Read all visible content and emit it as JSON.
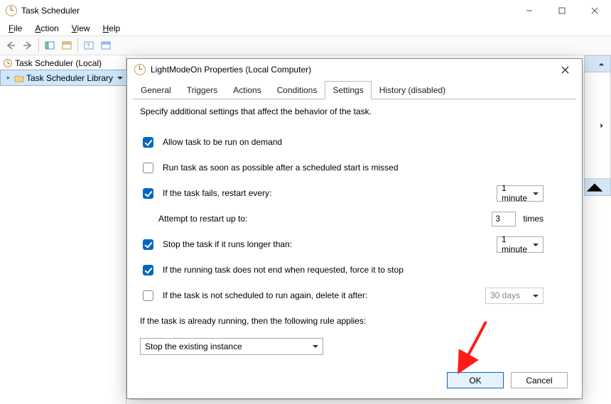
{
  "app": {
    "title": "Task Scheduler"
  },
  "menu": {
    "file": "File",
    "action": "Action",
    "view": "View",
    "help": "Help"
  },
  "tree": {
    "root": "Task Scheduler (Local)",
    "child": "Task Scheduler Library"
  },
  "dialog": {
    "title": "LightModeOn Properties (Local Computer)",
    "tabs": {
      "general": "General",
      "triggers": "Triggers",
      "actions": "Actions",
      "conditions": "Conditions",
      "settings": "Settings",
      "history": "History (disabled)"
    },
    "desc": "Specify additional settings that affect the behavior of the task.",
    "opts": {
      "allow_on_demand": "Allow task to be run on demand",
      "run_asap": "Run task as soon as possible after a scheduled start is missed",
      "fails_restart": "If the task fails, restart every:",
      "fails_interval": "1 minute",
      "restart_upto": "Attempt to restart up to:",
      "restart_count": "3",
      "restart_times": "times",
      "stop_longer": "Stop the task if it runs longer than:",
      "stop_duration": "1 minute",
      "force_stop": "If the running task does not end when requested, force it to stop",
      "delete_after": "If the task is not scheduled to run again, delete it after:",
      "delete_days": "30 days",
      "already_running": "If the task is already running, then the following rule applies:",
      "rule_selected": "Stop the existing instance"
    },
    "buttons": {
      "ok": "OK",
      "cancel": "Cancel"
    }
  }
}
